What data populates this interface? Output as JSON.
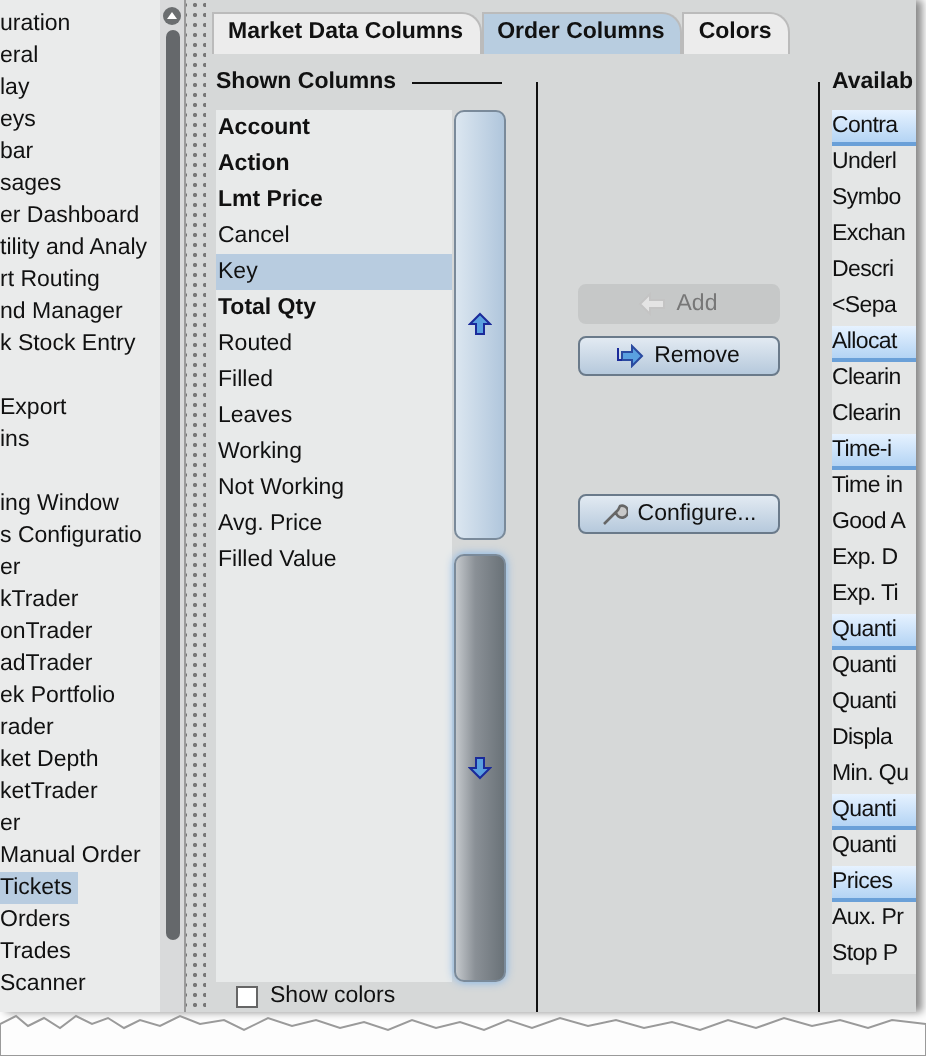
{
  "sidebar": {
    "sections": [
      [
        {
          "label": "uration",
          "selected": false
        },
        {
          "label": "eral",
          "selected": false
        },
        {
          "label": "lay",
          "selected": false
        },
        {
          "label": "eys",
          "selected": false
        },
        {
          "label": "bar",
          "selected": false
        },
        {
          "label": "sages",
          "selected": false
        },
        {
          "label": "er Dashboard",
          "selected": false
        },
        {
          "label": "tility and Analy",
          "selected": false
        },
        {
          "label": "rt Routing",
          "selected": false
        },
        {
          "label": "nd Manager",
          "selected": false
        },
        {
          "label": "k Stock Entry",
          "selected": false
        }
      ],
      [
        {
          "label": "Export",
          "selected": false
        },
        {
          "label": "ins",
          "selected": false
        }
      ],
      [
        {
          "label": "ing Window",
          "selected": false
        },
        {
          "label": "s Configuratio",
          "selected": false
        },
        {
          "label": "er",
          "selected": false
        },
        {
          "label": "kTrader",
          "selected": false
        },
        {
          "label": "onTrader",
          "selected": false
        },
        {
          "label": "adTrader",
          "selected": false
        },
        {
          "label": "ek Portfolio",
          "selected": false
        },
        {
          "label": "rader",
          "selected": false
        },
        {
          "label": "ket Depth",
          "selected": false
        },
        {
          "label": "ketTrader",
          "selected": false
        },
        {
          "label": "er",
          "selected": false
        },
        {
          "label": "Manual Order",
          "selected": false
        },
        {
          "label": "Tickets",
          "selected": true
        },
        {
          "label": "Orders",
          "selected": false
        },
        {
          "label": "Trades",
          "selected": false
        },
        {
          "label": "Scanner",
          "selected": false
        }
      ]
    ]
  },
  "tabs": [
    {
      "label": "Market Data Columns",
      "selected": false
    },
    {
      "label": "Order Columns",
      "selected": true
    },
    {
      "label": "Colors",
      "selected": false
    }
  ],
  "shown_columns": {
    "title": "Shown Columns",
    "items": [
      {
        "label": "Account",
        "bold": true,
        "selected": false
      },
      {
        "label": "Action",
        "bold": true,
        "selected": false
      },
      {
        "label": "Lmt Price",
        "bold": true,
        "selected": false
      },
      {
        "label": "Cancel",
        "bold": false,
        "selected": false
      },
      {
        "label": "Key",
        "bold": false,
        "selected": true
      },
      {
        "label": "Total Qty",
        "bold": true,
        "selected": false
      },
      {
        "label": "Routed",
        "bold": false,
        "selected": false
      },
      {
        "label": "Filled",
        "bold": false,
        "selected": false
      },
      {
        "label": "Leaves",
        "bold": false,
        "selected": false
      },
      {
        "label": "Working",
        "bold": false,
        "selected": false
      },
      {
        "label": "Not Working",
        "bold": false,
        "selected": false
      },
      {
        "label": "Avg. Price",
        "bold": false,
        "selected": false
      },
      {
        "label": "Filled Value",
        "bold": false,
        "selected": false
      }
    ],
    "move_buttons": [
      {
        "kind": "up",
        "hovered": false
      },
      {
        "kind": "down",
        "hovered": true
      }
    ],
    "show_colors": {
      "label": "Show colors",
      "checked": false
    }
  },
  "actions": [
    {
      "kind": "add",
      "label": "Add",
      "disabled": true
    },
    {
      "kind": "remove",
      "label": "Remove",
      "disabled": false
    },
    {
      "kind": "configure",
      "label": "Configure...",
      "disabled": false
    }
  ],
  "available_columns": {
    "title": "Availab",
    "items": [
      {
        "label": "Contra",
        "kind": "group"
      },
      {
        "label": "Underl",
        "kind": "item"
      },
      {
        "label": "Symbo",
        "kind": "item"
      },
      {
        "label": "Exchan",
        "kind": "item"
      },
      {
        "label": "Descri",
        "kind": "item"
      },
      {
        "label": "<Sepa",
        "kind": "item"
      },
      {
        "label": "Allocat",
        "kind": "group"
      },
      {
        "label": "Clearin",
        "kind": "item"
      },
      {
        "label": "Clearin",
        "kind": "item"
      },
      {
        "label": "Time-i",
        "kind": "group"
      },
      {
        "label": "Time in",
        "kind": "item"
      },
      {
        "label": "Good A",
        "kind": "item"
      },
      {
        "label": "Exp. D",
        "kind": "item"
      },
      {
        "label": "Exp. Ti",
        "kind": "item"
      },
      {
        "label": "Quanti",
        "kind": "group"
      },
      {
        "label": "Quanti",
        "kind": "item"
      },
      {
        "label": "Quanti",
        "kind": "item"
      },
      {
        "label": "Displa",
        "kind": "item"
      },
      {
        "label": "Min. Qu",
        "kind": "item"
      },
      {
        "label": "Quanti",
        "kind": "group"
      },
      {
        "label": "Quanti",
        "kind": "item"
      },
      {
        "label": "Prices",
        "kind": "group"
      },
      {
        "label": "Aux. Pr",
        "kind": "item"
      },
      {
        "label": "Stop P",
        "kind": "item"
      }
    ]
  }
}
